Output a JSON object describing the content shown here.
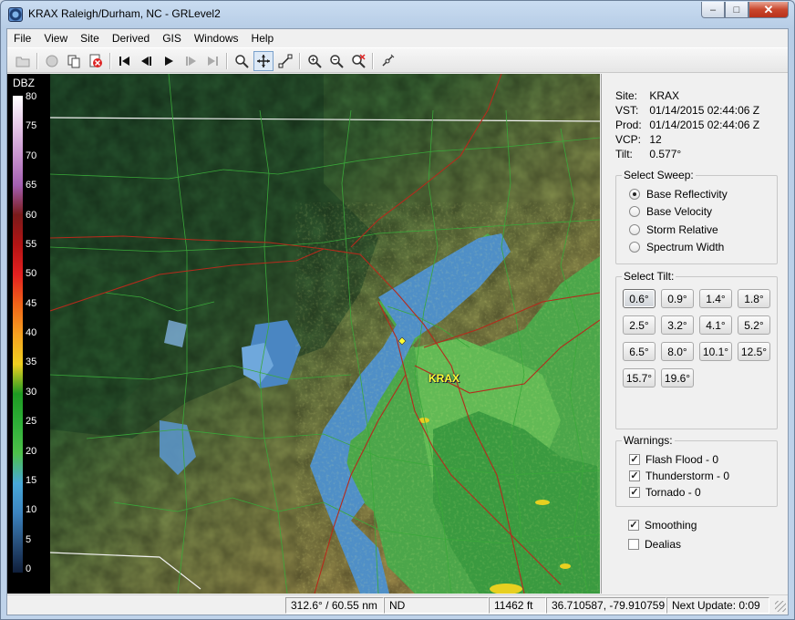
{
  "window": {
    "title": "KRAX Raleigh/Durham, NC - GRLevel2",
    "controls": {
      "minimize": "–",
      "maximize": "□",
      "close": "✕"
    }
  },
  "menu": [
    "File",
    "View",
    "Site",
    "Derived",
    "GIS",
    "Windows",
    "Help"
  ],
  "toolbar": {
    "icons": [
      "open-folder-icon",
      "stop-icon",
      "copy-icon",
      "cancel-icon",
      "skip-start-icon",
      "step-back-icon",
      "play-icon",
      "step-forward-icon",
      "skip-end-icon",
      "zoom-icon",
      "pan-icon",
      "measure-icon",
      "zoom-in-icon",
      "zoom-out-icon",
      "zoom-reset-icon",
      "link-icon"
    ]
  },
  "legend": {
    "title": "DBZ",
    "ticks": [
      "80",
      "75",
      "70",
      "65",
      "60",
      "55",
      "50",
      "45",
      "40",
      "35",
      "30",
      "25",
      "20",
      "15",
      "10",
      "5",
      "0"
    ],
    "colors": [
      "#ffffff",
      "#e6c8e8",
      "#c894cf",
      "#a35fb1",
      "#7a1a1a",
      "#b31414",
      "#e32020",
      "#f06418",
      "#f5a020",
      "#f0d020",
      "#1e9a22",
      "#2eb038",
      "#4ec04a",
      "#48a8d8",
      "#3c84c0",
      "#28507c",
      "#0f1e3a"
    ]
  },
  "map": {
    "site_label": "KRAX"
  },
  "info": {
    "site": {
      "label": "Site:",
      "value": "KRAX"
    },
    "vst": {
      "label": "VST:",
      "value": "01/14/2015  02:44:06 Z"
    },
    "prod": {
      "label": "Prod:",
      "value": "01/14/2015  02:44:06 Z"
    },
    "vcp": {
      "label": "VCP:",
      "value": "12"
    },
    "tilt": {
      "label": "Tilt:",
      "value": "0.577°"
    }
  },
  "sweep": {
    "title": "Select Sweep:",
    "options": [
      {
        "label": "Base Reflectivity",
        "selected": true
      },
      {
        "label": "Base Velocity",
        "selected": false
      },
      {
        "label": "Storm Relative",
        "selected": false
      },
      {
        "label": "Spectrum Width",
        "selected": false
      }
    ]
  },
  "tilts": {
    "title": "Select Tilt:",
    "values": [
      "0.6°",
      "0.9°",
      "1.4°",
      "1.8°",
      "2.5°",
      "3.2°",
      "4.1°",
      "5.2°",
      "6.5°",
      "8.0°",
      "10.1°",
      "12.5°",
      "15.7°",
      "19.6°"
    ],
    "active_index": 0
  },
  "warnings": {
    "title": "Warnings:",
    "items": [
      {
        "label": "Flash Flood - 0",
        "checked": true
      },
      {
        "label": "Thunderstorm - 0",
        "checked": true
      },
      {
        "label": "Tornado - 0",
        "checked": true
      }
    ]
  },
  "options": [
    {
      "label": "Smoothing",
      "checked": true
    },
    {
      "label": "Dealias",
      "checked": false
    }
  ],
  "status": {
    "cursor": "312.6° / 60.55 nm",
    "value": "ND",
    "height": "11462 ft",
    "coords": "36.710587, -79.910759",
    "next_update": "Next Update: 0:09"
  }
}
